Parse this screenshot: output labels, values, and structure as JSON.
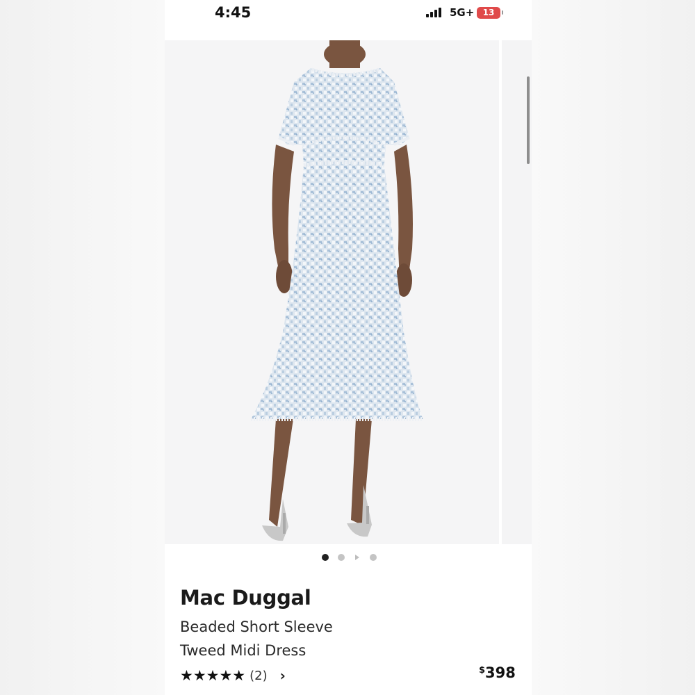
{
  "status_bar": {
    "time": "4:45",
    "network": "5G+",
    "battery": "13"
  },
  "gallery": {
    "image_count": 4,
    "active_index": 0,
    "colors": {
      "dress": "#c9d7e6",
      "active_dot": "#222222",
      "inactive_dot": "#c4c4c4"
    }
  },
  "product": {
    "brand": "Mac Duggal",
    "name_line1": "Beaded Short Sleeve",
    "name_line2": "Tweed Midi Dress",
    "stars": "★★★★★",
    "rating": 5,
    "review_count": "(2)",
    "price_symbol": "$",
    "price_value": "398"
  }
}
